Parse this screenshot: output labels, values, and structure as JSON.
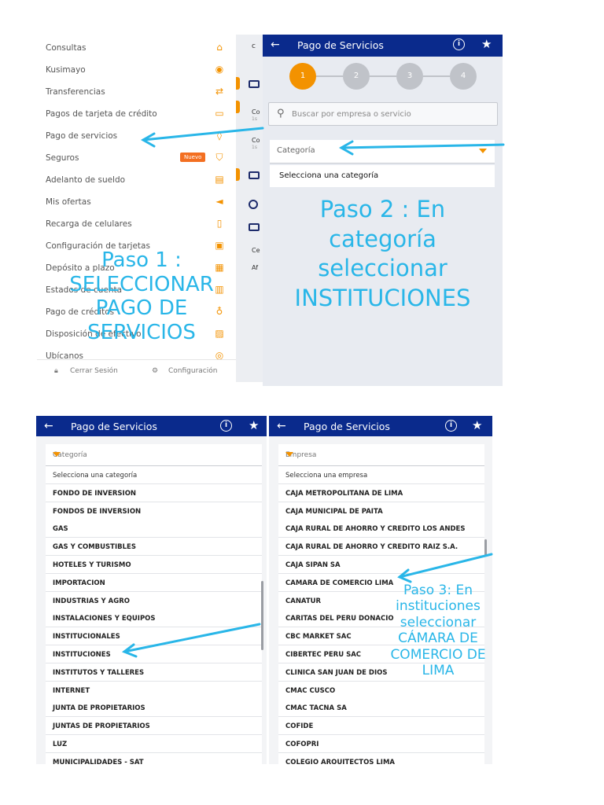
{
  "panel1": {
    "menu": [
      {
        "label": "Consultas",
        "icon": "home-icon",
        "glyph": "⌂"
      },
      {
        "label": "Kusimayo",
        "icon": "kusimayo-icon",
        "glyph": "◉"
      },
      {
        "label": "Transferencias",
        "icon": "transfer-icon",
        "glyph": "⇄"
      },
      {
        "label": "Pagos de tarjeta de crédito",
        "icon": "card-icon",
        "glyph": "▭"
      },
      {
        "label": "Pago de servicios",
        "icon": "drop-icon",
        "glyph": "◊"
      },
      {
        "label": "Seguros",
        "icon": "shield-icon",
        "glyph": "⛉",
        "badge": "Nuevo"
      },
      {
        "label": "Adelanto de sueldo",
        "icon": "cash-icon",
        "glyph": "▤"
      },
      {
        "label": "Mis ofertas",
        "icon": "megaphone-icon",
        "glyph": "◄"
      },
      {
        "label": "Recarga de celulares",
        "icon": "phone-icon",
        "glyph": "▯"
      },
      {
        "label": "Configuración de tarjetas",
        "icon": "card-settings-icon",
        "glyph": "▣"
      },
      {
        "label": "Depósito a plazo",
        "icon": "deposit-icon",
        "glyph": "▦"
      },
      {
        "label": "Estados de cuenta",
        "icon": "statement-icon",
        "glyph": "▥"
      },
      {
        "label": "Pago de créditos",
        "icon": "credit-icon",
        "glyph": "♁"
      },
      {
        "label": "Disposición de efectivo",
        "icon": "wallet-icon",
        "glyph": "▨"
      },
      {
        "label": "Ubícanos",
        "icon": "location-icon",
        "glyph": "◎"
      }
    ],
    "footer": {
      "logout": "Cerrar Sesión",
      "settings": "Configuración"
    },
    "annotation": [
      "Paso 1 :",
      "SELECCIONAR",
      "PAGO DE",
      "SERVICIOS"
    ]
  },
  "background_strip": {
    "letter": "c",
    "items": [
      "Co",
      "1s",
      "Co",
      "1s",
      "Ce",
      "Af"
    ]
  },
  "panel2": {
    "title": "Pago de Servicios",
    "steps": [
      "1",
      "2",
      "3",
      "4"
    ],
    "search_placeholder": "Buscar por empresa o servicio",
    "category_label": "Categoría",
    "category_option": "Selecciona una categoría",
    "annotation": [
      "Paso 2 : En",
      "categoría",
      "seleccionar",
      "INSTITUCIONES"
    ]
  },
  "panel3": {
    "title": "Pago de Servicios",
    "header": "Categoría",
    "items": [
      "Selecciona una categoría",
      "FONDO DE INVERSION",
      "FONDOS DE INVERSION",
      "GAS",
      "GAS Y COMBUSTIBLES",
      "HOTELES Y TURISMO",
      "IMPORTACION",
      "INDUSTRIAS Y AGRO",
      "INSTALACIONES Y EQUIPOS",
      "INSTITUCIONALES",
      "INSTITUCIONES",
      "INSTITUTOS Y TALLERES",
      "INTERNET",
      "JUNTA DE PROPIETARIOS",
      "JUNTAS DE PROPIETARIOS",
      "LUZ",
      "MUNICIPALIDADES - SAT"
    ]
  },
  "panel4": {
    "title": "Pago de Servicios",
    "header": "Empresa",
    "items": [
      "Selecciona una empresa",
      "CAJA METROPOLITANA DE LIMA",
      "CAJA MUNICIPAL DE PAITA",
      "CAJA RURAL DE AHORRO Y CREDITO LOS ANDES",
      "CAJA RURAL DE AHORRO Y CREDITO RAIZ S.A.",
      "CAJA SIPAN SA",
      "CAMARA DE COMERCIO LIMA",
      "CANATUR",
      "CARITAS DEL PERU DONACIO",
      "CBC MARKET SAC",
      "CIBERTEC PERU SAC",
      "CLINICA SAN JUAN DE DIOS",
      "CMAC CUSCO",
      "CMAC TACNA SA",
      "COFIDE",
      "COFOPRI",
      "COLEGIO ARQUITECTOS LIMA"
    ],
    "annotation": [
      "Paso 3: En",
      "instituciones",
      "seleccionar",
      "CÁMARA DE",
      "COMERCIO DE",
      "LIMA"
    ]
  },
  "colors": {
    "primary": "#0a2a8c",
    "accent": "#f39200",
    "annotation": "#29b6e8"
  }
}
